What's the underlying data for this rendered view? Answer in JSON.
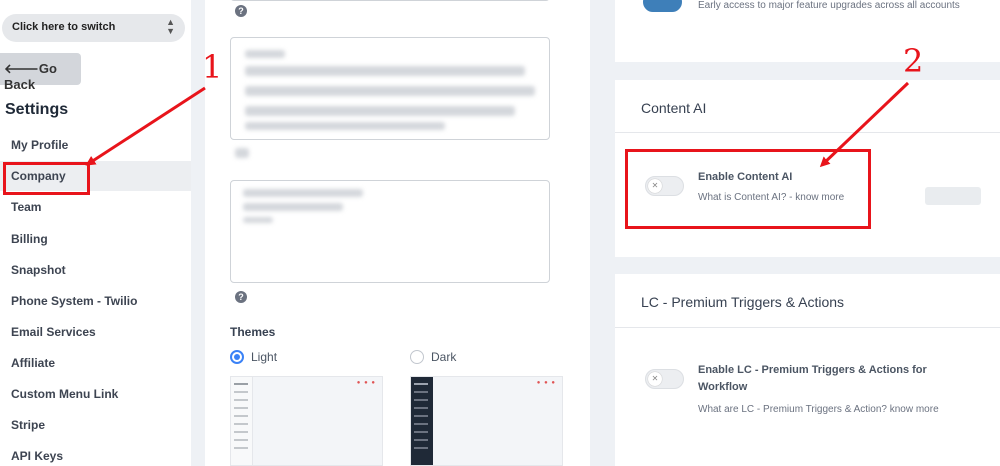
{
  "sidebar": {
    "switcher_label": "Click here to switch",
    "go_back_label": "Go Back",
    "settings_title": "Settings",
    "items": [
      {
        "label": "My Profile"
      },
      {
        "label": "Company"
      },
      {
        "label": "Team"
      },
      {
        "label": "Billing"
      },
      {
        "label": "Snapshot"
      },
      {
        "label": "Phone System - Twilio"
      },
      {
        "label": "Email Services"
      },
      {
        "label": "Affiliate"
      },
      {
        "label": "Custom Menu Link"
      },
      {
        "label": "Stripe"
      },
      {
        "label": "API Keys"
      }
    ],
    "active_item": "Company"
  },
  "middle": {
    "help_glyph": "?",
    "themes_label": "Themes",
    "themes": [
      {
        "label": "Light",
        "selected": true
      },
      {
        "label": "Dark",
        "selected": false
      }
    ]
  },
  "right": {
    "labs_description": "Early access to major feature upgrades across all accounts",
    "content_ai": {
      "section_title": "Content AI",
      "option_title": "Enable Content AI",
      "option_description": "What is Content AI? - know more",
      "enabled": false
    },
    "lc_premium": {
      "section_title": "LC - Premium Triggers & Actions",
      "option_title": "Enable LC - Premium Triggers & Actions for Workflow",
      "option_description": "What are LC - Premium Triggers & Action? know more",
      "enabled": false
    }
  },
  "annotations": {
    "marker_1": "1",
    "marker_2": "2",
    "color": "#e8141b"
  },
  "colors": {
    "accent": "#3b82f6",
    "annotation": "#e8141b"
  }
}
